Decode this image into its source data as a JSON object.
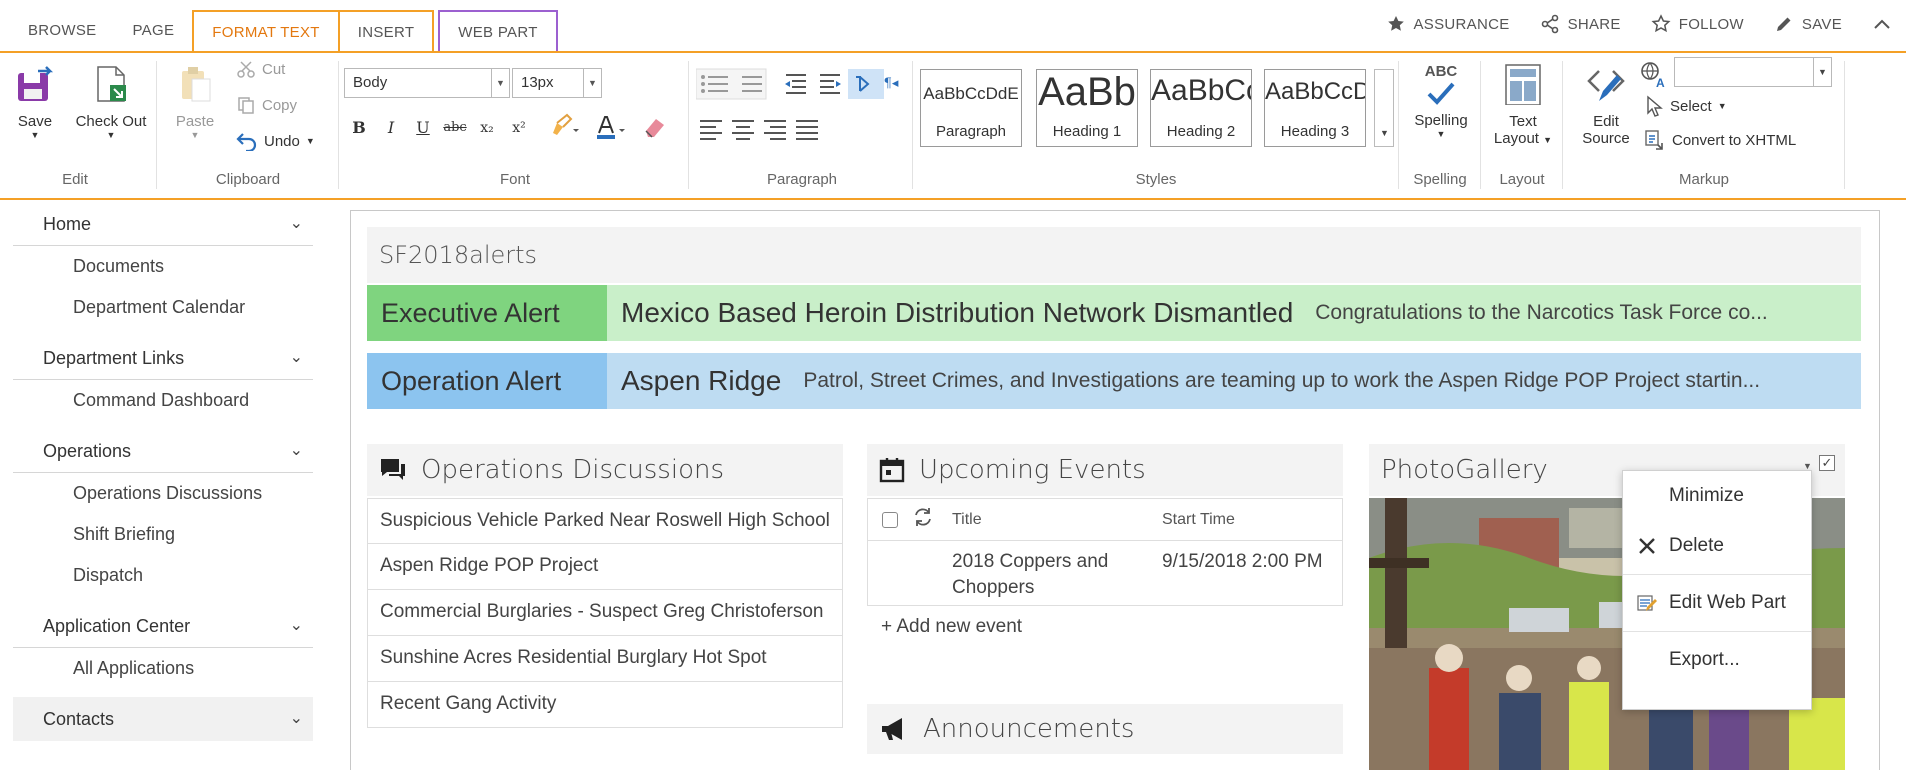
{
  "tabs": [
    "BROWSE",
    "PAGE",
    "FORMAT TEXT",
    "INSERT",
    "WEB PART"
  ],
  "top_actions": [
    "ASSURANCE",
    "SHARE",
    "FOLLOW",
    "SAVE"
  ],
  "ribbon": {
    "edit": {
      "save": "Save",
      "checkout": "Check Out",
      "label": "Edit"
    },
    "clipboard": {
      "paste": "Paste",
      "cut": "Cut",
      "copy": "Copy",
      "undo": "Undo",
      "label": "Clipboard"
    },
    "font": {
      "family": "Body",
      "size": "13px",
      "label": "Font"
    },
    "paragraph": {
      "label": "Paragraph"
    },
    "styles": {
      "items": [
        {
          "preview": "AaBbCcDdE",
          "name": "Paragraph"
        },
        {
          "preview": "AaBb",
          "name": "Heading 1"
        },
        {
          "preview": "AaBbCc",
          "name": "Heading 2"
        },
        {
          "preview": "AaBbCcD",
          "name": "Heading 3"
        }
      ],
      "label": "Styles"
    },
    "spelling": {
      "abc": "ABC",
      "button": "Spelling",
      "label": "Spelling"
    },
    "layout": {
      "line1": "Text",
      "line2": "Layout",
      "label": "Layout"
    },
    "markup": {
      "edit1": "Edit",
      "edit2": "Source",
      "select": "Select",
      "convert": "Convert to XHTML",
      "label": "Markup"
    }
  },
  "nav": {
    "home": "Home",
    "documents": "Documents",
    "calendar": "Department Calendar",
    "dept_links": "Department Links",
    "command": "Command Dashboard",
    "operations": "Operations",
    "ops_discussions": "Operations Discussions",
    "shift": "Shift Briefing",
    "dispatch": "Dispatch",
    "app_center": "Application Center",
    "all_apps": "All Applications",
    "contacts": "Contacts"
  },
  "zone_title": "SF2018alerts",
  "alerts": [
    {
      "tag": "Executive Alert",
      "headline": "Mexico Based Heroin Distribution Network Dismantled",
      "body": "Congratulations to the Narcotics Task Force co..."
    },
    {
      "tag": "Operation Alert",
      "headline": "Aspen Ridge",
      "body": "Patrol, Street Crimes, and Investigations are teaming up to work the Aspen Ridge POP Project startin..."
    }
  ],
  "discussions": {
    "title": "Operations Discussions",
    "items": [
      "Suspicious Vehicle Parked Near Roswell High School",
      "Aspen Ridge POP Project",
      "Commercial Burglaries - Suspect Greg Christoferson",
      "Sunshine Acres Residential Burglary Hot Spot",
      "Recent Gang Activity"
    ]
  },
  "events": {
    "title": "Upcoming Events",
    "col_title": "Title",
    "col_start": "Start Time",
    "rows": [
      {
        "title": "2018 Coppers and Choppers",
        "start": "9/15/2018 2:00 PM"
      }
    ],
    "add": "Add new event"
  },
  "announcements": {
    "title": "Announcements"
  },
  "photo": {
    "title": "PhotoGallery"
  },
  "menu": [
    "Minimize",
    "Delete",
    "Edit Web Part",
    "Export..."
  ],
  "colors": {
    "accent": "#f4a026",
    "webpart_tab": "#9c60d0",
    "exec_tag": "#7fd47f",
    "exec_bg": "#c9efc9",
    "op_tag": "#8cc4ef",
    "op_bg": "#bedcf2",
    "blue_icon": "#2a6ebb"
  }
}
